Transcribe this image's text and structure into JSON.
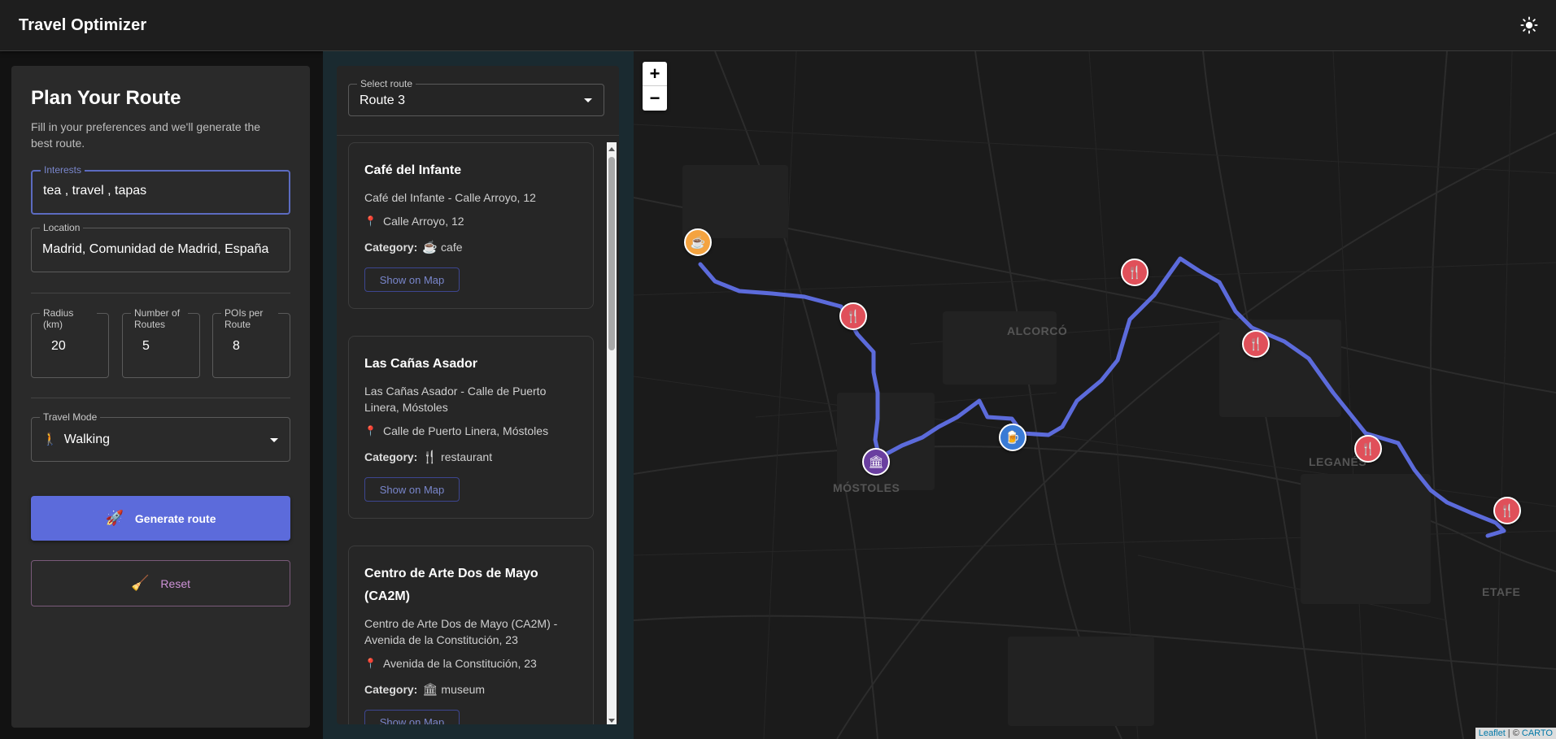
{
  "header": {
    "title": "Travel Optimizer",
    "theme_icon": "sun-icon"
  },
  "form": {
    "title": "Plan Your Route",
    "subtitle": "Fill in your preferences and we'll generate the best route.",
    "interests_label": "Interests",
    "interests_value": "tea , travel , tapas",
    "location_label": "Location",
    "location_value": "Madrid, Comunidad de Madrid, España",
    "radius_label": "Radius (km)",
    "radius_value": "20",
    "routes_label": "Number of Routes",
    "routes_value": "5",
    "pois_label": "POIs per Route",
    "pois_value": "8",
    "mode_label": "Travel Mode",
    "mode_icon": "🚶",
    "mode_value": "Walking",
    "generate_icon": "🚀",
    "generate_label": "Generate route",
    "reset_icon": "🧹",
    "reset_label": "Reset",
    "accent_color": "#5c6bdb"
  },
  "routes": {
    "select_label": "Select route",
    "selected": "Route 3",
    "cards": [
      {
        "title": "Café del Infante",
        "desc": "Café del Infante - Calle Arroyo, 12",
        "address": "Calle Arroyo, 12",
        "category_label": "Category:",
        "category_icon": "☕",
        "category": "cafe",
        "button": "Show on Map"
      },
      {
        "title": "Las Cañas Asador",
        "desc": "Las Cañas Asador - Calle de Puerto Linera, Móstoles",
        "address": "Calle de Puerto Linera, Móstoles",
        "category_label": "Category:",
        "category_icon": "🍴",
        "category": "restaurant",
        "button": "Show on Map"
      },
      {
        "title": "Centro de Arte Dos de Mayo (CA2M)",
        "desc": "Centro de Arte Dos de Mayo (CA2M) - Avenida de la Constitución, 23",
        "address": "Avenida de la Constitución, 23",
        "category_label": "Category:",
        "category_icon": "🏛",
        "category": "museum",
        "button": "Show on Map"
      }
    ]
  },
  "map": {
    "zoom_in": "+",
    "zoom_out": "−",
    "labels": [
      "ALCORCÓ",
      "MÓSTOLES",
      "LEGANÉS",
      "ETAFE"
    ],
    "attribution_leaflet": "Leaflet",
    "attribution_sep": " | © ",
    "attribution_carto": "CARTO",
    "route_color": "#5c6bdb",
    "markers": [
      {
        "type": "cafe",
        "icon": "☕",
        "color": "#f4a340"
      },
      {
        "type": "restaurant",
        "icon": "🍴",
        "color": "#e0505a"
      },
      {
        "type": "museum",
        "icon": "🏛",
        "color": "#6a3fa0"
      },
      {
        "type": "bar",
        "icon": "🍺",
        "color": "#3a7bd5"
      },
      {
        "type": "restaurant",
        "icon": "🍴",
        "color": "#e0505a"
      },
      {
        "type": "restaurant",
        "icon": "🍴",
        "color": "#e0505a"
      },
      {
        "type": "restaurant",
        "icon": "🍴",
        "color": "#e0505a"
      },
      {
        "type": "restaurant",
        "icon": "🍴",
        "color": "#e0505a"
      }
    ]
  }
}
